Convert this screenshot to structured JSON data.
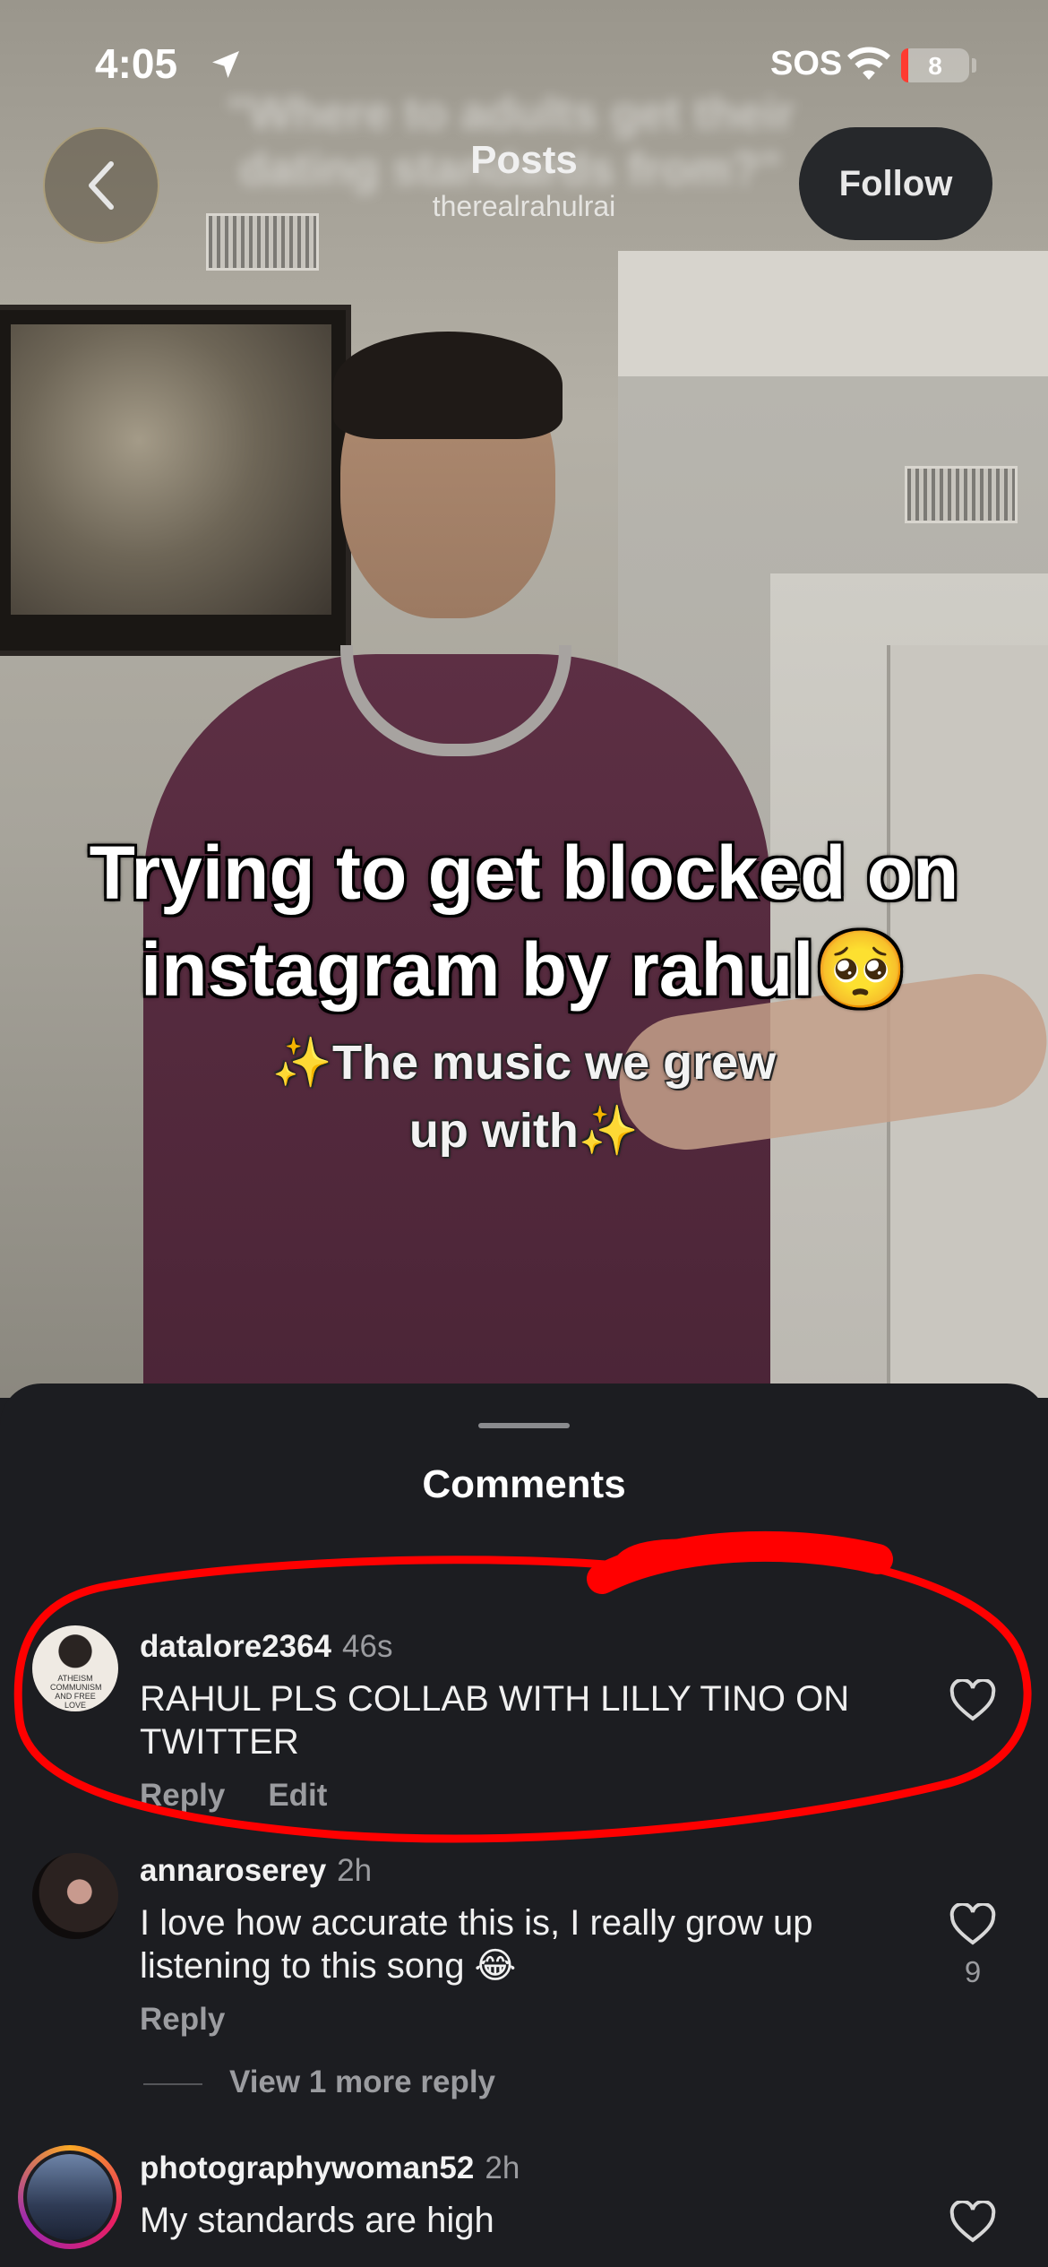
{
  "status_bar": {
    "time": "4:05",
    "carrier_label": "SOS",
    "battery": "8"
  },
  "nav": {
    "title": "Posts",
    "username": "therealrahulrai",
    "follow_label": "Follow",
    "blurred_caption": "\"Where to adults get their dating standards from?\""
  },
  "video": {
    "caption": "Trying to get blocked on instagram by rahul🥺",
    "sub_caption": "✨The music we grew up with✨"
  },
  "sheet": {
    "title": "Comments"
  },
  "comments": [
    {
      "username": "datalore2364",
      "time": "46s",
      "text": "RAHUL PLS COLLAB WITH LILLY TINO ON TWITTER",
      "reply_label": "Reply",
      "edit_label": "Edit",
      "avatar_shirt_text": "ATHEISM COMMUNISM AND FREE LOVE"
    },
    {
      "username": "annaroserey",
      "time": "2h",
      "text": "I love how accurate this is, I really grow up listening to this song 😂",
      "reply_label": "Reply",
      "likes": "9",
      "more_replies": "View 1 more reply"
    },
    {
      "username": "photographywoman52",
      "time": "2h",
      "text": "My standards are high"
    }
  ],
  "colors": {
    "sheet_bg": "#1c1d21",
    "annotation_red": "#ff0000",
    "muted_text": "#9b9ca0"
  },
  "icons": [
    "location-arrow-icon",
    "wifi-icon",
    "battery-icon",
    "chevron-left-icon",
    "heart-icon"
  ]
}
